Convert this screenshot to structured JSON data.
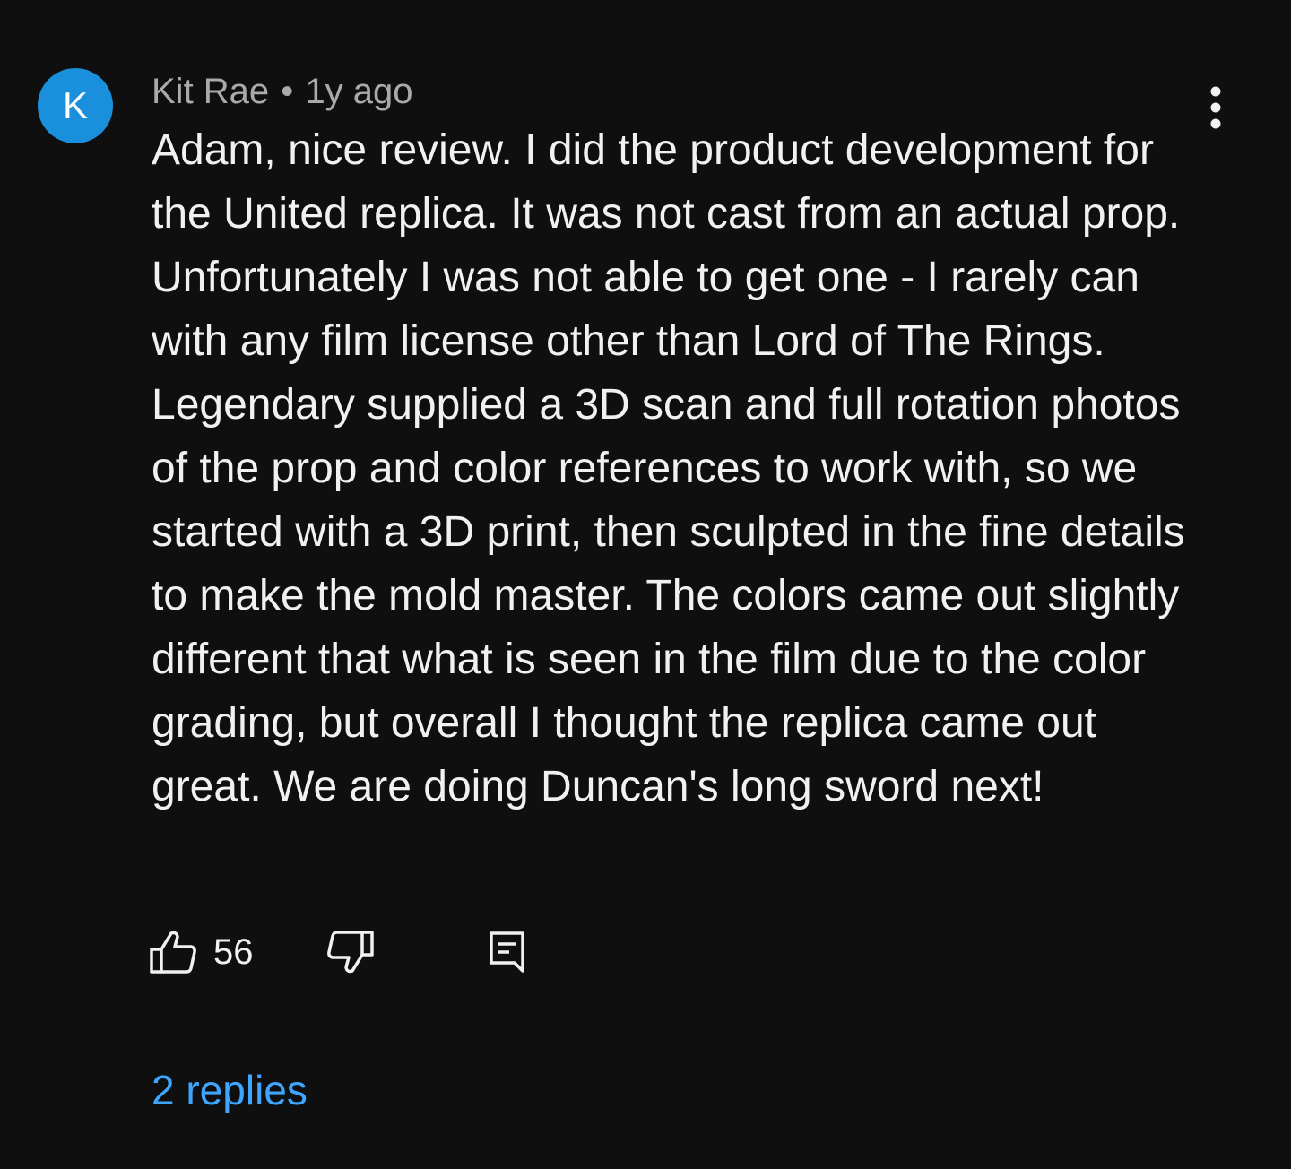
{
  "comment": {
    "avatar_letter": "K",
    "avatar_color": "#1a8fdb",
    "author": "Kit Rae",
    "separator": "•",
    "timestamp": "1y ago",
    "text": "Adam, nice review. I did the product development for the United replica. It was not cast from an actual prop. Unfortunately I was not able to get one - I rarely can with any film license other than Lord of The Rings. Legendary supplied a 3D scan and full rotation photos of the prop and color references to work with, so we started with a 3D print, then sculpted in the fine details to make the mold master. The colors came out slightly different that what is seen in the film due to the color grading, but overall I thought the replica came out great. We are doing Duncan's long sword next!",
    "like_count": "56",
    "replies_label": "2 replies",
    "link_color": "#3ea6ff"
  },
  "icons": {
    "more": "more-vertical-icon",
    "like": "thumbs-up-icon",
    "dislike": "thumbs-down-icon",
    "reply": "comment-reply-icon"
  }
}
